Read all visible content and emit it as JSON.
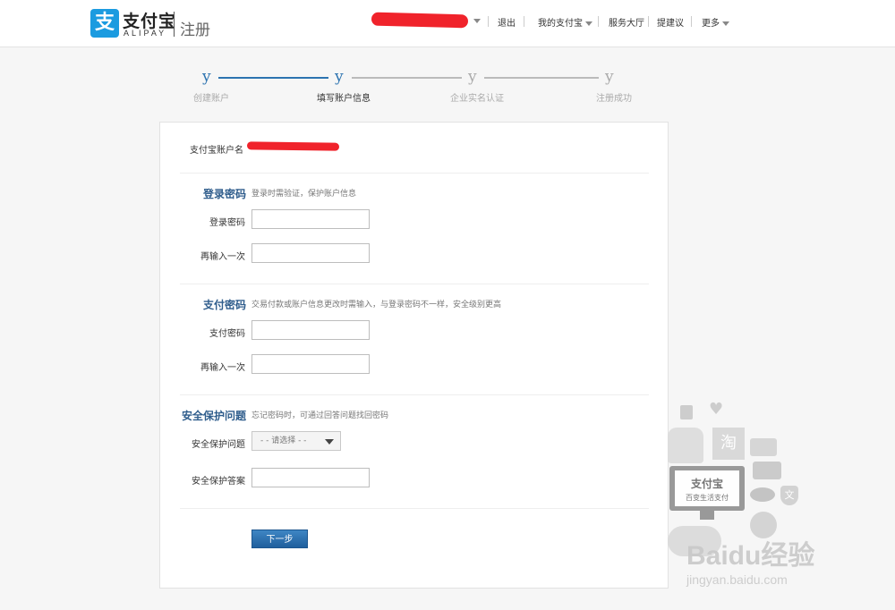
{
  "header": {
    "logo_glyph": "支",
    "brand_name": "支付宝",
    "brand_sub": "ALIPAY",
    "page_title": "注册",
    "nav": {
      "logout": "退出",
      "my_alipay": "我的支付宝",
      "service_hall": "服务大厅",
      "suggest": "提建议",
      "more": "更多"
    }
  },
  "steps": [
    {
      "mark": "y",
      "label": "创建账户",
      "state": "done"
    },
    {
      "mark": "y",
      "label": "填写账户信息",
      "state": "current"
    },
    {
      "mark": "y",
      "label": "企业实名认证",
      "state": "todo"
    },
    {
      "mark": "y",
      "label": "注册成功",
      "state": "todo"
    }
  ],
  "account": {
    "label": "支付宝账户名"
  },
  "login_password": {
    "title": "登录密码",
    "desc": "登录时需验证，保护账户信息",
    "field1_label": "登录密码",
    "field2_label": "再输入一次"
  },
  "pay_password": {
    "title": "支付密码",
    "desc": "交易付款或账户信息更改时需输入，与登录密码不一样，安全级别更高",
    "field1_label": "支付密码",
    "field2_label": "再输入一次"
  },
  "security_question": {
    "title": "安全保护问题",
    "desc": "忘记密码时，可通过回答问题找回密码",
    "question_label": "安全保护问题",
    "question_placeholder": "- - 请选择 - -",
    "answer_label": "安全保护答案"
  },
  "next_button": "下一步",
  "watermark": {
    "card_title": "支付宝",
    "card_sub": "百变生活支付",
    "taobao_glyph": "淘",
    "baidu_text": "Baidu经验",
    "url": "jingyan.baidu.com"
  },
  "colors": {
    "accent": "#1f5f9d",
    "step_active": "#2c73b0",
    "section_title": "#2f5d8c",
    "redaction": "#f0232b"
  }
}
